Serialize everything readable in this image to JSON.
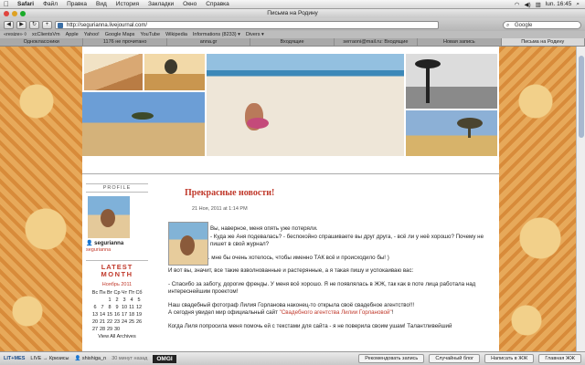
{
  "menubar": {
    "apple": "",
    "items": [
      "Safari",
      "Файл",
      "Правка",
      "Вид",
      "История",
      "Закладки",
      "Окно",
      "Справка"
    ],
    "clock": "lun. 16:45"
  },
  "window": {
    "title": "Письма на Родину"
  },
  "toolbar": {
    "back": "◀",
    "forward": "▶",
    "url": "http://segurianna.livejournal.com/",
    "search_value": "Google"
  },
  "bookmarks": [
    "«resize» ◊",
    "xcClientsVm",
    "Apple",
    "Yahoo!",
    "Google Maps",
    "YouTube",
    "Wikipedia",
    "Informations (8233) ▾",
    "Divers ▾"
  ],
  "tabs": [
    {
      "label": "Одноклассники",
      "active": false
    },
    {
      "label": "1176 не прочитано",
      "active": false
    },
    {
      "label": "anna.gr",
      "active": false
    },
    {
      "label": "Входящие",
      "active": false
    },
    {
      "label": "serraoni@mail.ru: Входящие",
      "active": false
    },
    {
      "label": "Новая запись",
      "active": false
    },
    {
      "label": "Письма на Родину",
      "active": true
    }
  ],
  "sidebar": {
    "profile_heading": "PROFILE",
    "username": "segurianna",
    "user_link": "segurianna",
    "latest_line1": "LATEST",
    "latest_line2": "MONTH",
    "calendar": {
      "month": "Ноябрь 2011",
      "days": [
        "Вс",
        "Пн",
        "Вт",
        "Ср",
        "Чт",
        "Пт",
        "Сб"
      ],
      "weeks": [
        [
          "",
          "",
          "1",
          "2",
          "3",
          "4",
          "5"
        ],
        [
          "6",
          "7",
          "8",
          "9",
          "10",
          "11",
          "12"
        ],
        [
          "13",
          "14",
          "15",
          "16",
          "17",
          "18",
          "19"
        ],
        [
          "20",
          "21",
          "22",
          "23",
          "24",
          "25",
          "26"
        ],
        [
          "27",
          "28",
          "29",
          "30",
          "",
          "",
          ""
        ]
      ]
    },
    "view_all": "View All Archives"
  },
  "post": {
    "title": "Прекрасные новости!",
    "date": "21 Ноя, 2011 at 1:14 PM",
    "p1": "Вы, наверное, меня опять уже потеряли.",
    "p2": "- Куда же Аня подевалась? - беспокойно спрашиваете вы друг друга, - всё ли у неё хорошо? Почему не пишет в свой журнал?",
    "p3": "Ну вернее как... мне бы очень хотелось, чтобы именно ТАК всё и происходило бы! )",
    "p4": "И вот вы, значит, все такие взволнованные и растерянные, а я такая пишу и успокаиваю вас:",
    "p5": "- Спасибо за заботу, дорогие френды. У меня всё хорошо. Я не появлялась в ЖЖ, так как в поте лица работала над интереснейшим проектом!",
    "p6": "Наш свадебный фотограф Лилия Горланова наконец-то открыла своё свадебное агентство!!!",
    "p7a": "А сегодня увидел мир официальный сайт ",
    "p7b": "\"Свадебного агентства Лилии Горлановой\"",
    "p7c": "!",
    "p8": "Когда Лиля попросила меня помочь ей с текстами для сайта - я не поверила своим ушам! Талантливейший"
  },
  "statusbar": {
    "logo": "LIT+MES",
    "live": "LIVE → Кризисы",
    "user": "shishiga_n",
    "user_note": "30 минут назад",
    "omgi": "OMGI",
    "btn1": "Рекомендовать запись",
    "btn2": "Случайный блог",
    "btn3": "Написать в ЖЖ",
    "btn4": "Главная ЖЖ"
  },
  "colors": {
    "accent_red": "#c0392b",
    "link_blue": "#1a4c8a"
  }
}
